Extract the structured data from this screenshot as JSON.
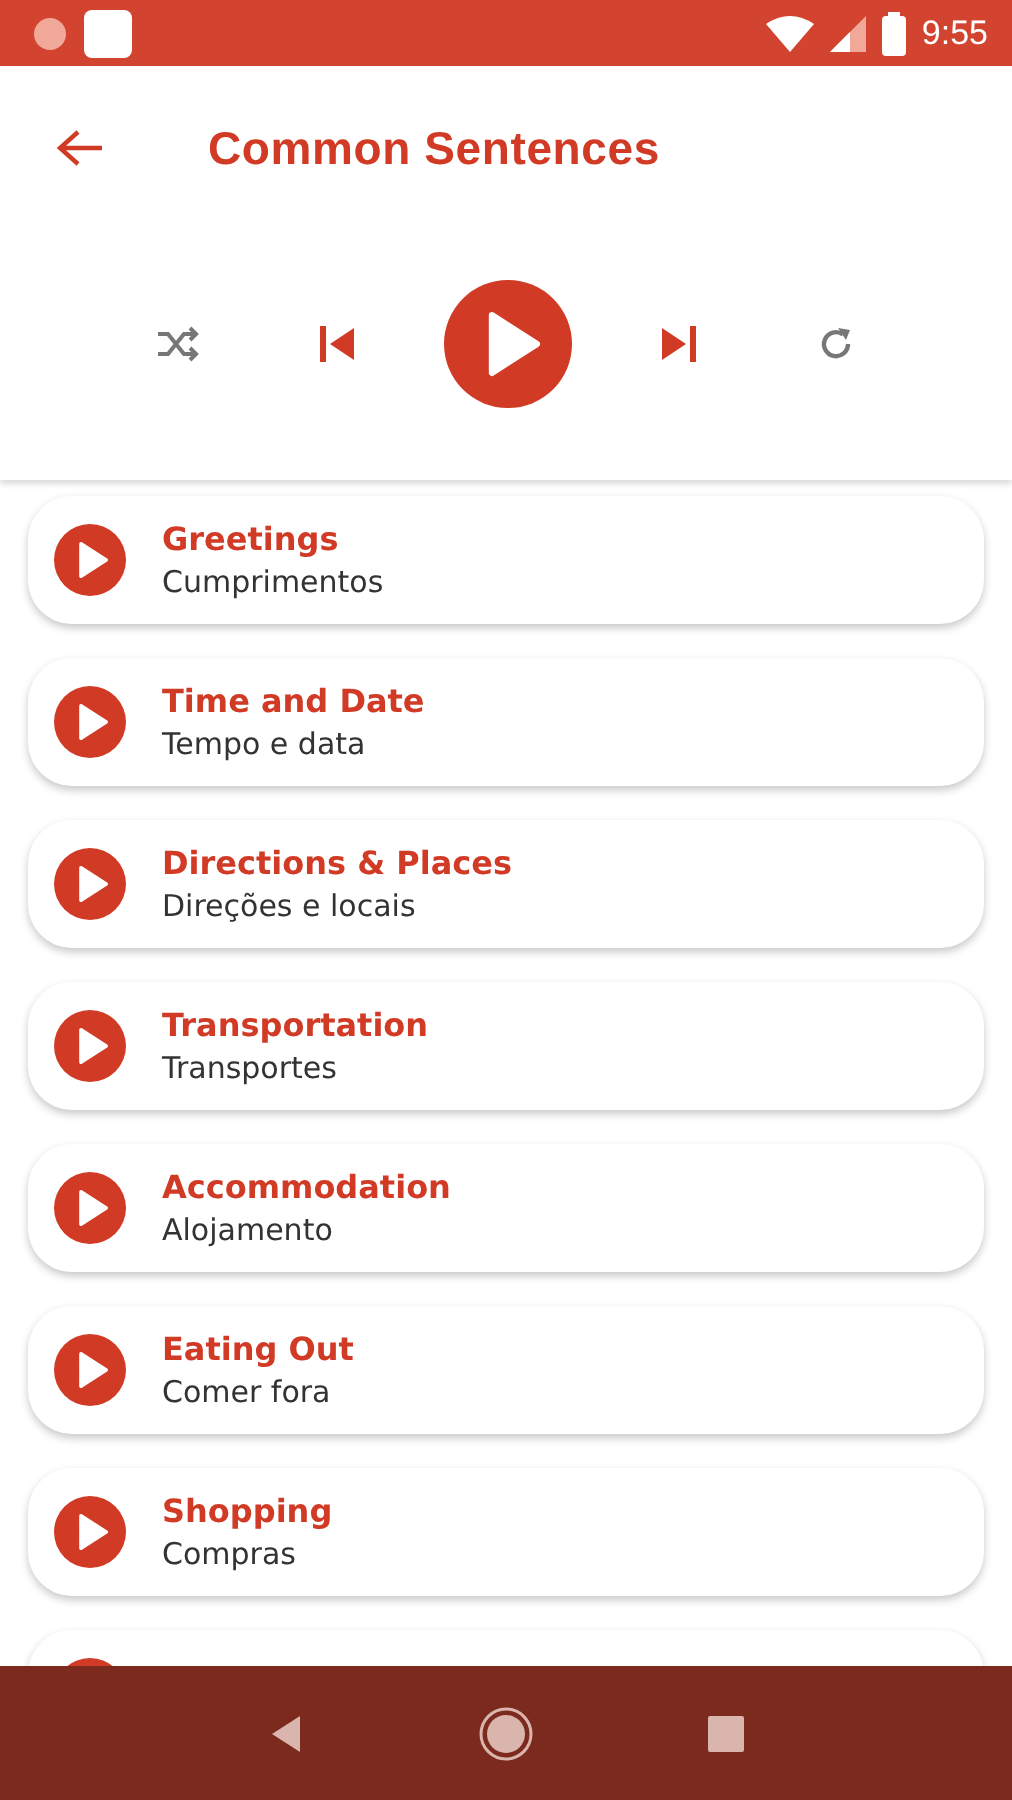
{
  "status_bar": {
    "time": "9:55"
  },
  "header": {
    "title": "Common Sentences"
  },
  "player": {
    "shuffle_on": false,
    "repeat_on": false
  },
  "categories": [
    {
      "title": "Greetings",
      "subtitle": "Cumprimentos"
    },
    {
      "title": "Time and Date",
      "subtitle": "Tempo e data"
    },
    {
      "title": "Directions & Places",
      "subtitle": "Direções e locais"
    },
    {
      "title": "Transportation",
      "subtitle": "Transportes"
    },
    {
      "title": "Accommodation",
      "subtitle": "Alojamento"
    },
    {
      "title": "Eating Out",
      "subtitle": "Comer fora"
    },
    {
      "title": "Shopping",
      "subtitle": "Compras"
    }
  ]
}
